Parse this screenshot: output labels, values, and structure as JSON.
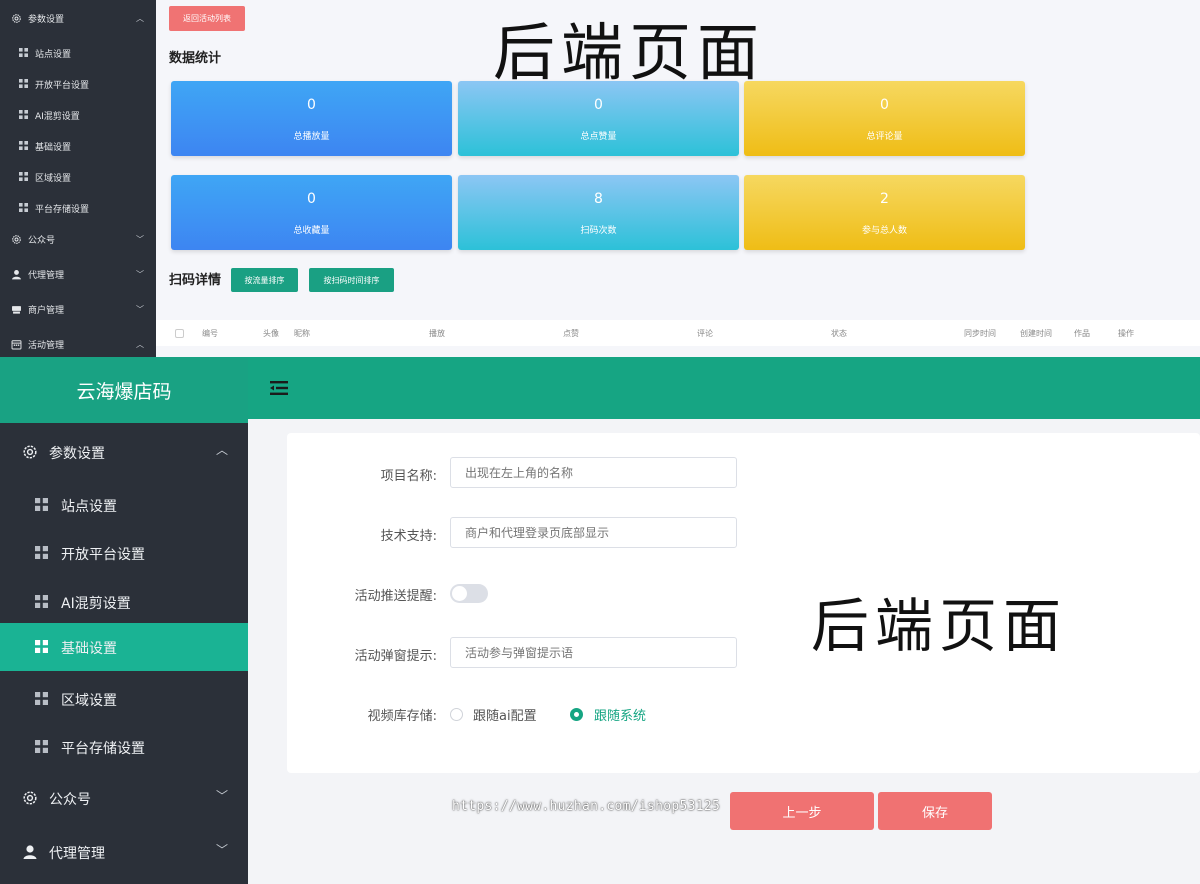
{
  "top": {
    "sidebar": {
      "items": [
        {
          "label": "参数设置",
          "icon": "gear-icon",
          "expanded": true
        },
        {
          "label": "公众号",
          "icon": "gear-icon",
          "expanded": false
        },
        {
          "label": "代理管理",
          "icon": "user-icon",
          "expanded": false
        },
        {
          "label": "商户管理",
          "icon": "shop-icon",
          "expanded": false
        },
        {
          "label": "活动管理",
          "icon": "calendar-icon",
          "expanded": true
        }
      ],
      "subitems": [
        "站点设置",
        "开放平台设置",
        "AI混剪设置",
        "基础设置",
        "区域设置",
        "平台存储设置"
      ]
    },
    "back_button": "返回活动列表",
    "stats_title": "数据统计",
    "stats": [
      {
        "value": "0",
        "label": "总播放量",
        "color": "blue"
      },
      {
        "value": "0",
        "label": "总点赞量",
        "color": "cyan"
      },
      {
        "value": "0",
        "label": "总评论量",
        "color": "yellow"
      },
      {
        "value": "0",
        "label": "总收藏量",
        "color": "blue"
      },
      {
        "value": "8",
        "label": "扫码次数",
        "color": "cyan"
      },
      {
        "value": "2",
        "label": "参与总人数",
        "color": "yellow"
      }
    ],
    "scan_title": "扫码详情",
    "sort_traffic": "按流量排序",
    "sort_scan_time": "按扫码时间排序",
    "table_headers": [
      "编号",
      "头像",
      "昵称",
      "播放",
      "点赞",
      "评论",
      "状态",
      "同步时间",
      "创建时间",
      "作品",
      "操作"
    ],
    "overlay_text": "后端页面"
  },
  "bottom": {
    "app_title": "云海爆店码",
    "sidebar": {
      "items": [
        {
          "label": "参数设置",
          "icon": "gear-icon",
          "expanded": true
        },
        {
          "label": "公众号",
          "icon": "gear-icon",
          "expanded": false
        },
        {
          "label": "代理管理",
          "icon": "user-icon",
          "expanded": false
        }
      ],
      "subitems": [
        "站点设置",
        "开放平台设置",
        "AI混剪设置",
        "基础设置",
        "区域设置",
        "平台存储设置"
      ],
      "active_subitem": "基础设置"
    },
    "form": {
      "project_name_label": "项目名称:",
      "project_name_placeholder": "出现在左上角的名称",
      "tech_support_label": "技术支持:",
      "tech_support_placeholder": "商户和代理登录页底部显示",
      "push_reminder_label": "活动推送提醒:",
      "push_reminder_on": false,
      "popup_tip_label": "活动弹窗提示:",
      "popup_tip_placeholder": "活动参与弹窗提示语",
      "video_storage_label": "视频库存储:",
      "storage_options": [
        "跟随ai配置",
        "跟随系统"
      ],
      "storage_selected": "跟随系统"
    },
    "prev_button": "上一步",
    "save_button": "保存",
    "overlay_text": "后端页面",
    "watermark_url": "https://www.huzhan.com/ishop53125"
  },
  "colors": {
    "sidebar_bg": "#2b3039",
    "brand_green": "#16a583",
    "active_green": "#1ab394",
    "danger_red": "#f07272"
  }
}
